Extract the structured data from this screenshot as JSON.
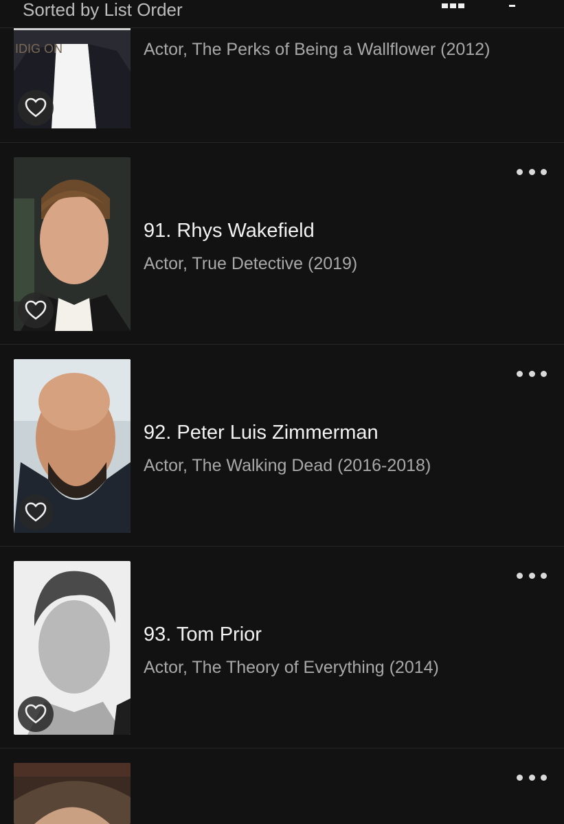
{
  "header": {
    "sort_label": "Sorted by List Order"
  },
  "items": [
    {
      "title": "",
      "subtitle": "Actor, The Perks of Being a Wallflower (2012)",
      "poster_text": "IDIG    ON"
    },
    {
      "title": "91. Rhys Wakefield",
      "subtitle": "Actor, True Detective (2019)"
    },
    {
      "title": "92. Peter Luis Zimmerman",
      "subtitle": "Actor, The Walking Dead (2016-2018)"
    },
    {
      "title": "93. Tom Prior",
      "subtitle": "Actor, The Theory of Everything (2014)"
    },
    {
      "title": "",
      "subtitle": ""
    }
  ],
  "icons": {
    "favorite": "heart-outline-icon",
    "more": "more-horizontal-icon",
    "view": "grid-view-icon",
    "filter": "filter-icon"
  },
  "colors": {
    "background": "#121212",
    "divider": "#262626",
    "title": "#f2f2f2",
    "subtitle": "#a9a9a9"
  }
}
